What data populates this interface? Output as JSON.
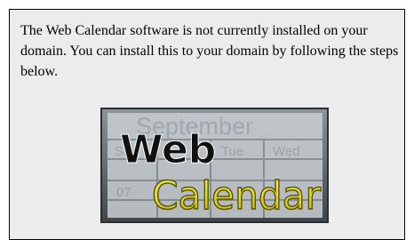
{
  "message": {
    "text": "The Web Calendar software is not currently installed on your domain. You can install this to your domain by following the steps below."
  },
  "logo": {
    "word_top": "Web",
    "word_bottom": "Calendar",
    "background_month": "September",
    "background_days": [
      "Sun",
      "Tue",
      "Wed"
    ],
    "background_date": "07"
  },
  "colors": {
    "panel_background": "#ececec",
    "panel_border": "#000000",
    "logo_text_top": "#111111",
    "logo_text_bottom": "#f0e826",
    "logo_grid": "#9aa2a8"
  }
}
